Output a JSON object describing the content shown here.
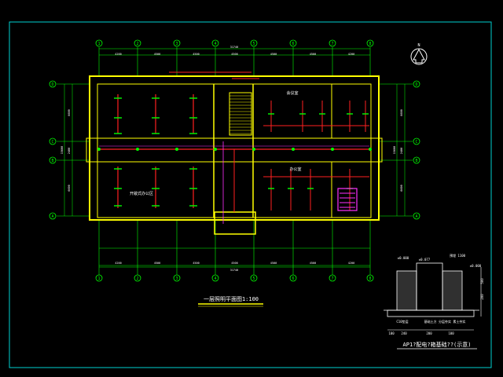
{
  "drawing": {
    "grid_columns": [
      "1",
      "2",
      "3",
      "4",
      "5",
      "6",
      "7",
      "8"
    ],
    "grid_rows": [
      "D",
      "C",
      "B",
      "A"
    ],
    "bay_dims": [
      "4200",
      "4500",
      "4500",
      "4500",
      "4500",
      "4500",
      "4200"
    ],
    "total_dim": "31740",
    "left_dims": [
      "6600",
      "2400",
      "6600"
    ],
    "left_total": "15600",
    "right_dims": [
      "6600",
      "2400",
      "6600"
    ],
    "right_total": "15600",
    "room_labels": {
      "meeting_room": "会议室",
      "office": "办公室",
      "open_office": "开敞式办公区"
    },
    "plan_title": "一层照明平面图1:100",
    "north_label": "N"
  },
  "detail": {
    "title": "AP1?配电?箱基础??(示意)",
    "label_top_left": "±0.000",
    "label_top_mid": "±0.077",
    "label_top_mid2": "预埋 1100",
    "label_right": "±0.000",
    "label_ground": "C10垫层",
    "label_notes": "基础土方 分层夯实 素土夯实",
    "dims_bottom": [
      "100",
      "240",
      "200",
      "100"
    ],
    "dims_side": [
      "200",
      "500"
    ]
  },
  "colors": {
    "background": "#000000",
    "frame": "#00d0d0",
    "grid": "#00ff00",
    "wall": "#ffff00",
    "wiring": "#ff2020",
    "magenta": "#ff30ff",
    "white": "#ffffff"
  }
}
